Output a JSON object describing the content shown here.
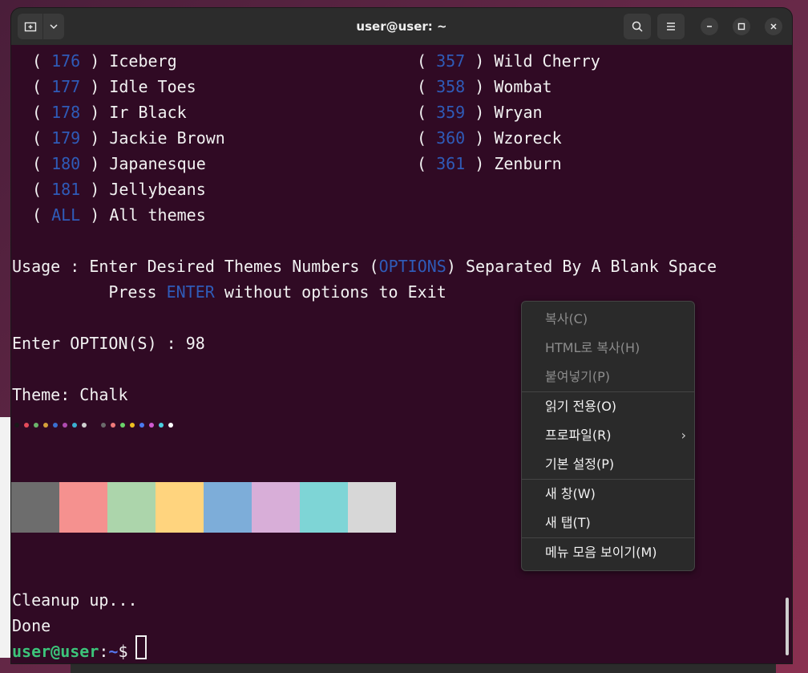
{
  "window": {
    "title": "user@user: ~"
  },
  "terminal": {
    "left_column": [
      {
        "num": "176",
        "name": "Iceberg"
      },
      {
        "num": "177",
        "name": "Idle Toes"
      },
      {
        "num": "178",
        "name": "Ir Black"
      },
      {
        "num": "179",
        "name": "Jackie Brown"
      },
      {
        "num": "180",
        "name": "Japanesque"
      },
      {
        "num": "181",
        "name": "Jellybeans"
      },
      {
        "num": "ALL",
        "name": "All themes"
      }
    ],
    "right_column": [
      {
        "num": "357",
        "name": "Wild Cherry"
      },
      {
        "num": "358",
        "name": "Wombat"
      },
      {
        "num": "359",
        "name": "Wryan"
      },
      {
        "num": "360",
        "name": "Wzoreck"
      },
      {
        "num": "361",
        "name": "Zenburn"
      }
    ],
    "usage_prefix": "Usage : Enter Desired Themes Numbers (",
    "usage_options": "OPTIONS",
    "usage_suffix": ") Separated By A Blank Space",
    "press_prefix": "        Press ",
    "press_enter": "ENTER",
    "press_suffix": " without options to Exit",
    "enter_option_line": "Enter OPTION(S) : 98",
    "theme_line": "Theme: Chalk",
    "cleanup_line": "Cleanup up...",
    "done_line": "Done",
    "prompt_user": "user@user",
    "prompt_colon": ":",
    "prompt_path": "~",
    "prompt_dollar": "$ "
  },
  "palette_dots": {
    "normal": [
      "#1a1a1a",
      "#e54a5a",
      "#6bb56b",
      "#d4a03a",
      "#3a70d0",
      "#b04ab0",
      "#3ab0d0",
      "#d0d0d0"
    ],
    "bright": [
      "#6a6a6a",
      "#f07a7a",
      "#6ad46a",
      "#f0c020",
      "#4a7af0",
      "#d05ad0",
      "#4ad0e0",
      "#ffffff"
    ]
  },
  "swatches": [
    "#6d6d6d",
    "#f5918f",
    "#acd5ab",
    "#ffd47e",
    "#7dadd9",
    "#d8aed8",
    "#7ed5d6",
    "#d7d7d7"
  ],
  "context_menu": {
    "items": [
      {
        "label": "복사(C)",
        "disabled": true
      },
      {
        "label": "HTML로 복사(H)",
        "disabled": true
      },
      {
        "label": "붙여넣기(P)",
        "disabled": true
      },
      {
        "label": "읽기 전용(O)",
        "disabled": false
      },
      {
        "label": "프로파일(R)",
        "disabled": false,
        "submenu": true
      },
      {
        "label": "기본 설정(P)",
        "disabled": false
      },
      {
        "label": "새 창(W)",
        "disabled": false
      },
      {
        "label": "새 탭(T)",
        "disabled": false
      },
      {
        "label": "메뉴 모음 보이기(M)",
        "disabled": false
      }
    ]
  }
}
